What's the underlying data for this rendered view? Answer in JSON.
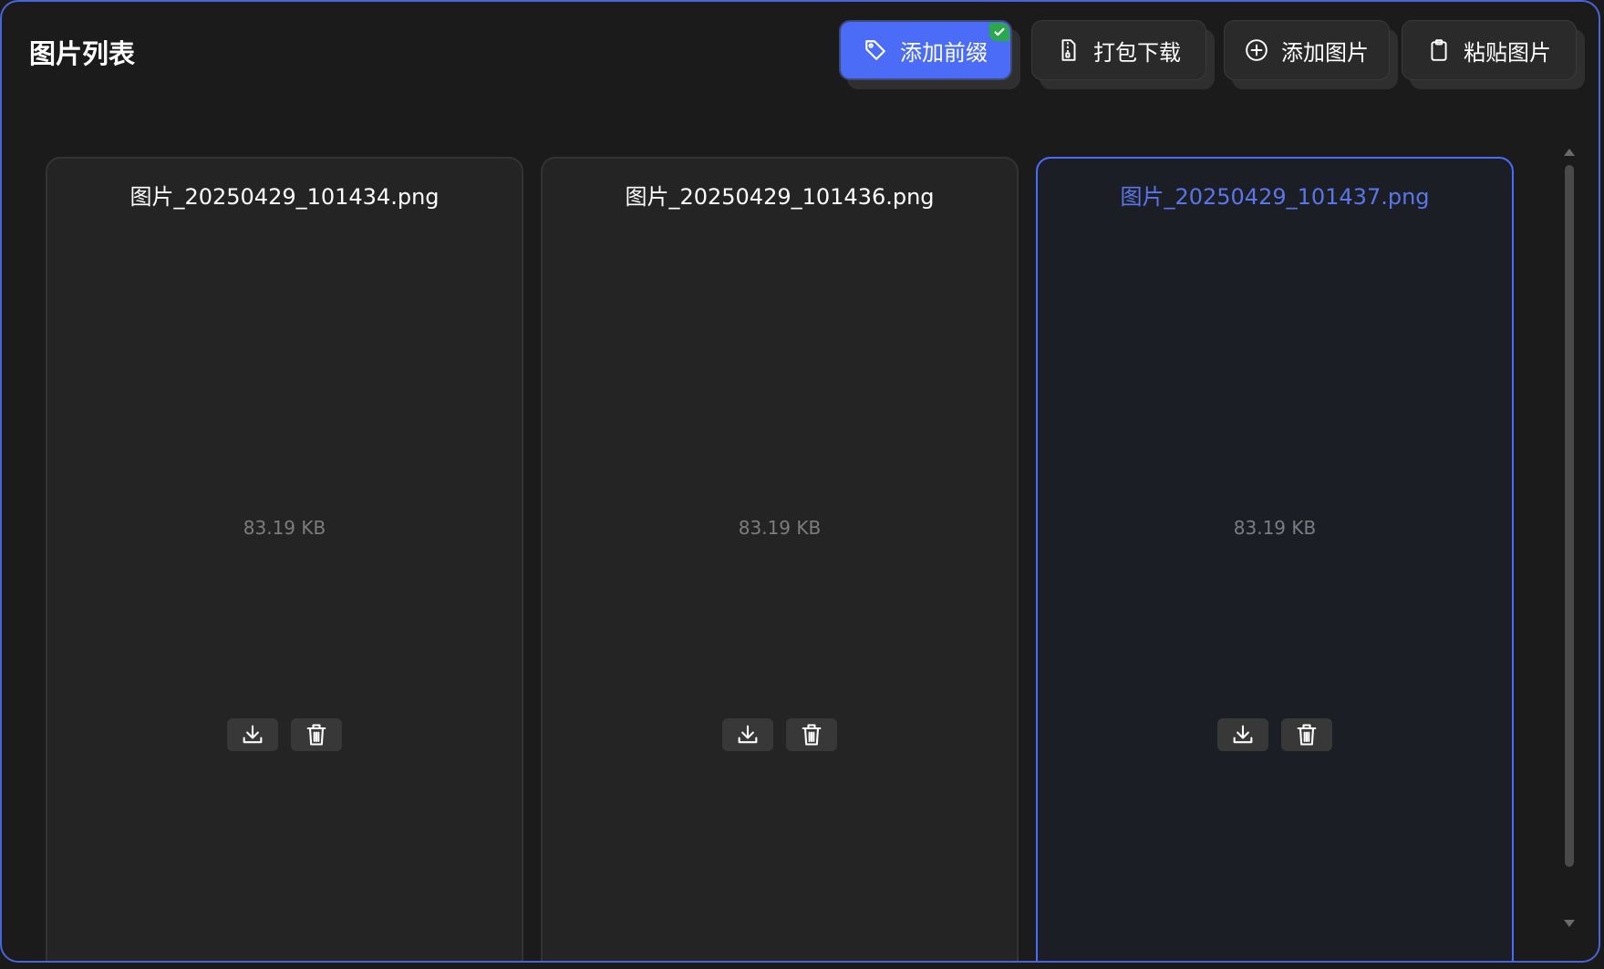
{
  "header": {
    "title": "图片列表"
  },
  "toolbar": {
    "add_prefix_label": "添加前缀",
    "pack_download_label": "打包下载",
    "add_image_label": "添加图片",
    "paste_image_label": "粘贴图片"
  },
  "images": [
    {
      "name": "图片_20250429_101434.png",
      "size": "83.19 KB"
    },
    {
      "name": "图片_20250429_101436.png",
      "size": "83.19 KB"
    },
    {
      "name": "图片_20250429_101437.png",
      "size": "83.19 KB"
    }
  ],
  "icons": {
    "add_prefix": "tag-icon",
    "add_prefix_badge": "checkmark-icon",
    "pack_download": "zip-file-icon",
    "add_image": "plus-circle-icon",
    "paste_image": "clipboard-icon",
    "download": "download-icon",
    "delete": "trash-icon"
  },
  "colors": {
    "accent": "#4a6cf7",
    "panel_border": "#4a63d8",
    "background": "#1b1b1b",
    "card": "#242424",
    "selected_card": "#1c1e26",
    "badge": "#2aa84a"
  }
}
